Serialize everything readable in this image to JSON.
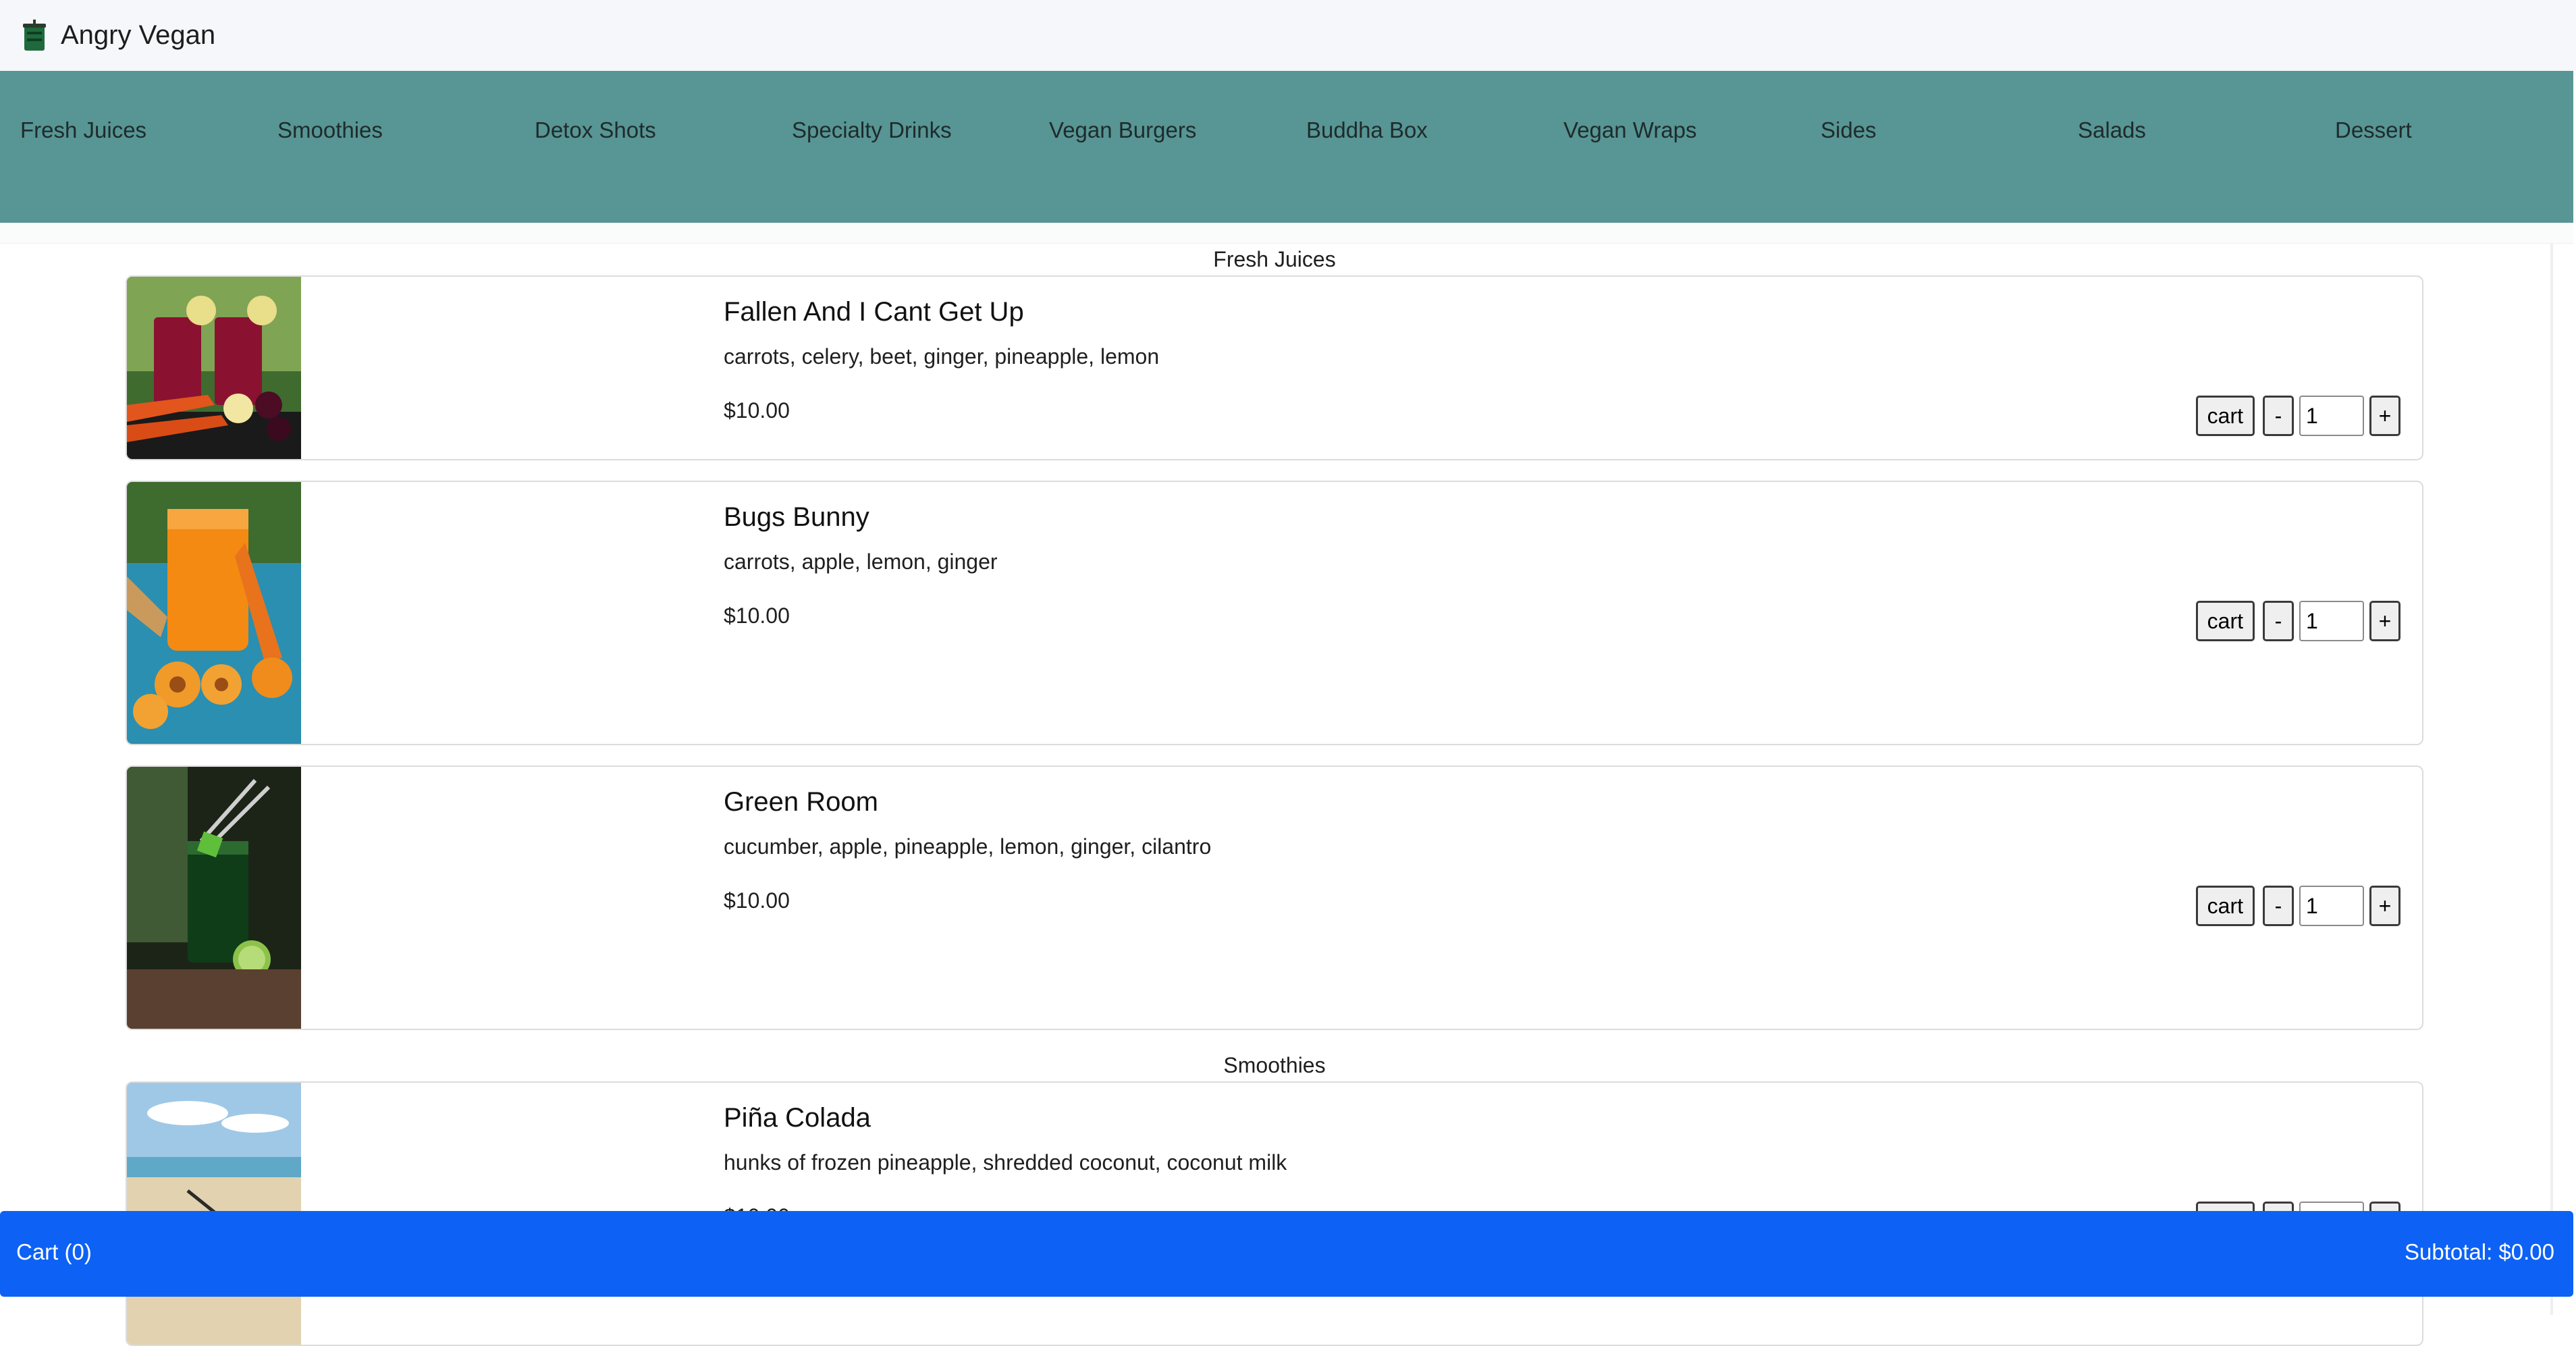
{
  "brand": {
    "name": "Angry Vegan",
    "logo_icon": "juice-cup-icon"
  },
  "categories": [
    "Fresh Juices",
    "Smoothies",
    "Detox Shots",
    "Specialty Drinks",
    "Vegan Burgers",
    "Buddha Box",
    "Vegan Wraps",
    "Sides",
    "Salads",
    "Dessert"
  ],
  "sections": [
    {
      "title": "Fresh Juices",
      "items": [
        {
          "name": "Fallen And I Cant Get Up",
          "description": "carrots, celery, beet, ginger, pineapple, lemon",
          "price": "$10.00",
          "qty": "1"
        },
        {
          "name": "Bugs Bunny",
          "description": "carrots, apple, lemon, ginger",
          "price": "$10.00",
          "qty": "1"
        },
        {
          "name": "Green Room",
          "description": "cucumber, apple, pineapple, lemon, ginger, cilantro",
          "price": "$10.00",
          "qty": "1"
        }
      ]
    },
    {
      "title": "Smoothies",
      "items": [
        {
          "name": "Piña Colada",
          "description": "hunks of frozen pineapple, shredded coconut, coconut milk",
          "price": "$10.00",
          "qty": "1"
        }
      ]
    }
  ],
  "controls": {
    "cart_label": "cart",
    "minus_label": "-",
    "plus_label": "+"
  },
  "cart": {
    "label": "Cart (0)",
    "subtotal": "Subtotal: $0.00"
  },
  "colors": {
    "nav": "#589595",
    "cart_bar": "#0d62f5",
    "top_bar": "#f6f7fa"
  }
}
